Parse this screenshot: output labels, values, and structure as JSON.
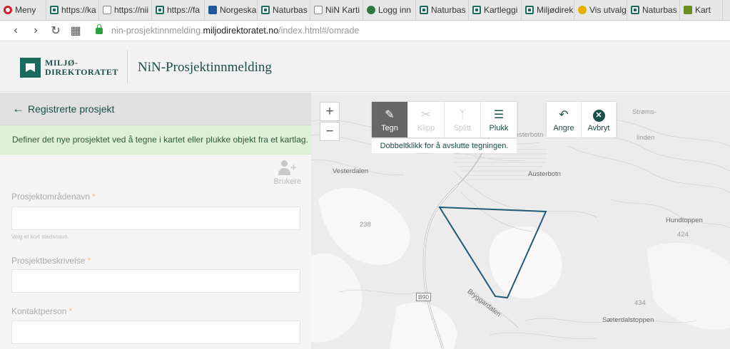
{
  "browser": {
    "tabs": [
      {
        "label": "Meny",
        "icon": "opera-icon"
      },
      {
        "label": "https://ka",
        "icon": "green-favicon"
      },
      {
        "label": "https://nii",
        "icon": "doc-favicon"
      },
      {
        "label": "https://fa",
        "icon": "green-favicon"
      },
      {
        "label": "Norgeska",
        "icon": "norgeskart-favicon"
      },
      {
        "label": "Naturbas",
        "icon": "green-favicon"
      },
      {
        "label": "NiN Karti",
        "icon": "doc-favicon"
      },
      {
        "label": "Logg inn",
        "icon": "globe-favicon"
      },
      {
        "label": "Naturbas",
        "icon": "green-favicon"
      },
      {
        "label": "Kartleggi",
        "icon": "green-favicon"
      },
      {
        "label": "Miljødirek",
        "icon": "green-favicon"
      },
      {
        "label": "Vis utvalg",
        "icon": "vis-favicon"
      },
      {
        "label": "Naturbas",
        "icon": "green-favicon"
      },
      {
        "label": "Kart",
        "icon": "kart-favicon"
      }
    ],
    "url_prefix": "nin-prosjektinnmelding.",
    "url_domain": "miljodirektoratet.no",
    "url_suffix": "/index.html#/omrade"
  },
  "header": {
    "logo_line1": "MILJØ-",
    "logo_line2": "DIREKTORATET",
    "title": "NiN-Prosjektinnmelding"
  },
  "panel": {
    "back_label": "Registrerte prosjekt",
    "info_text": "Definer det nye prosjektet ved å tegne i kartet eller plukke objekt fra et kartlag.",
    "users_label": "Brukere",
    "fields": [
      {
        "label": "Prosjektområdenavn",
        "required_mark": "*",
        "value": "",
        "help": "Velg et kort stedsnavn."
      },
      {
        "label": "Prosjektbeskrivelse",
        "required_mark": "*",
        "value": ""
      },
      {
        "label": "Kontaktperson",
        "required_mark": "*",
        "value": ""
      }
    ]
  },
  "map": {
    "zoom_in": "+",
    "zoom_out": "−",
    "tools": [
      {
        "label": "Tegn",
        "icon": "pencil-icon",
        "state": "active"
      },
      {
        "label": "Klipp",
        "icon": "scissors-icon",
        "state": "disabled"
      },
      {
        "label": "Splitt",
        "icon": "split-icon",
        "state": "disabled"
      },
      {
        "label": "Plukk",
        "icon": "layers-icon",
        "state": "enabled"
      }
    ],
    "hint": "Dobbeltklikk for å avslutte tegningen.",
    "actions": [
      {
        "label": "Angre",
        "icon": "undo-icon"
      },
      {
        "label": "Avbryt",
        "icon": "cancel-icon"
      }
    ],
    "place_labels": [
      "Strøms-",
      "linden",
      "Vesterbotn",
      "Vesterdalen",
      "Austerbotn",
      "Hundtoppen",
      "424",
      "238",
      "B90",
      "Bryggardalen",
      "434",
      "Sæterdalstoppen"
    ],
    "polygon_color": "#1f5a78"
  }
}
